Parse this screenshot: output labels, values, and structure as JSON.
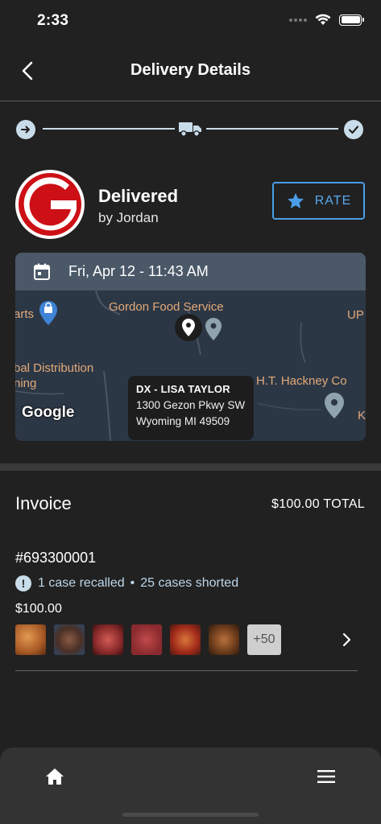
{
  "status_bar": {
    "time": "2:33"
  },
  "header": {
    "title": "Delivery Details"
  },
  "progress": {
    "stage": "delivered",
    "steps": [
      "arrow-right-icon",
      "truck-icon",
      "check-icon"
    ]
  },
  "carrier": {
    "status": "Delivered",
    "driver": "by Jordan",
    "rate_label": "RATE",
    "logo_letter": "G"
  },
  "map": {
    "datetime": "Fri, Apr 12 - 11:43 AM",
    "labels": {
      "gordon": "Gordon Food Service",
      "arts": "arts",
      "ups": "UP",
      "distribution1": "bal Distribution",
      "distribution2": "ning",
      "hackney": "H.T. Hackney Co",
      "k": "K"
    },
    "popup": {
      "name": "DX - LISA TAYLOR",
      "address1": "1300 Gezon Pkwy SW",
      "address2": "Wyoming MI 49509"
    },
    "attribution": "Google"
  },
  "invoice": {
    "title": "Invoice",
    "total": "$100.00 TOTAL",
    "order": {
      "number": "#693300001",
      "recalled": "1 case recalled",
      "separator": "•",
      "shorted": "25 cases shorted",
      "amount": "$100.00",
      "more_count": "+50"
    }
  },
  "colors": {
    "background": "#212121",
    "accent": "#4a9ee8",
    "progress": "#c9dce9",
    "map_bar": "#4a5868",
    "map_label": "#e3a977",
    "brand_red": "#cc1016"
  }
}
